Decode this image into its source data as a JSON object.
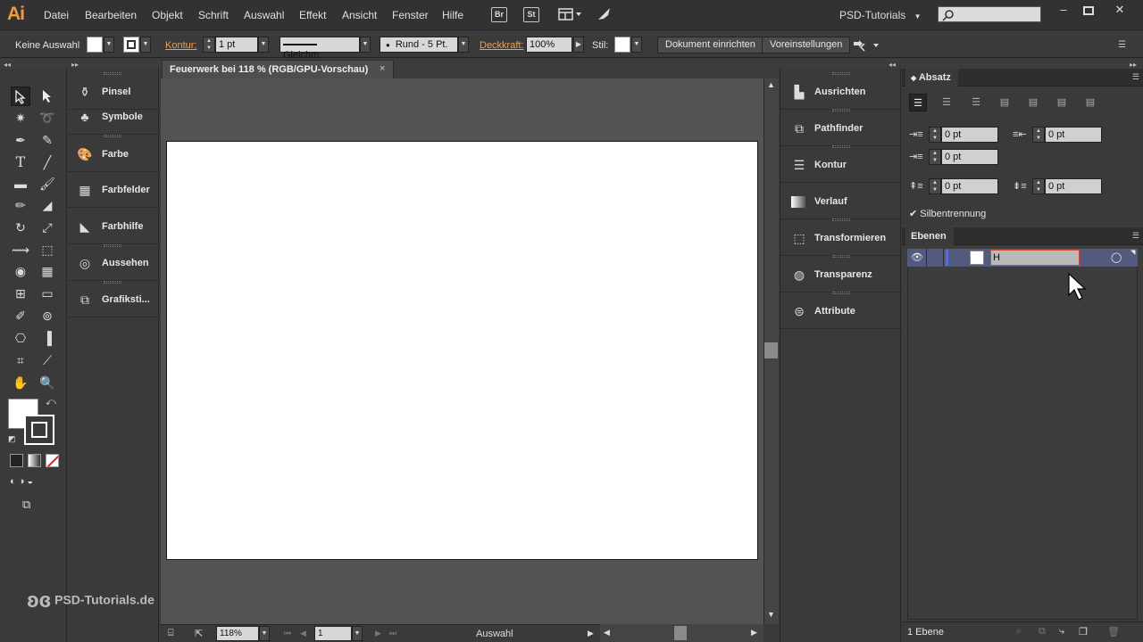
{
  "menubar": {
    "logo": "Ai",
    "items": [
      "Datei",
      "Bearbeiten",
      "Objekt",
      "Schrift",
      "Auswahl",
      "Effekt",
      "Ansicht",
      "Fenster",
      "Hilfe"
    ],
    "bridge_label": "Br",
    "stock_label": "St",
    "workspace": "PSD-Tutorials",
    "search_placeholder": ""
  },
  "controlbar": {
    "selection_state": "Keine Auswahl",
    "stroke_label": "Kontur:",
    "stroke_weight": "1 pt",
    "stroke_profile": "Gleichm.",
    "brush": "Rund - 5 Pt.",
    "opacity_label": "Deckkraft:",
    "opacity_value": "100%",
    "style_label": "Stil:",
    "doc_setup_button": "Dokument einrichten",
    "preferences_button": "Voreinstellungen"
  },
  "dock1": {
    "items": [
      {
        "label": "Pinsel",
        "icon": "brush-icon"
      },
      {
        "label": "Symbole",
        "icon": "symbols-icon"
      },
      {
        "label": "Farbe",
        "icon": "color-palette-icon"
      },
      {
        "label": "Farbfelder",
        "icon": "swatches-icon"
      },
      {
        "label": "Farbhilfe",
        "icon": "color-guide-icon"
      },
      {
        "label": "Aussehen",
        "icon": "appearance-icon"
      },
      {
        "label": "Grafiksti...",
        "icon": "graphic-styles-icon"
      }
    ]
  },
  "document": {
    "tab_title": "Feuerwerk bei 118 % (RGB/GPU-Vorschau)",
    "close_symbol": "×"
  },
  "statusbar": {
    "zoom": "118%",
    "artboard_number": "1",
    "tool_status": "Auswahl"
  },
  "dock2": {
    "items": [
      {
        "label": "Ausrichten",
        "icon": "align-icon"
      },
      {
        "label": "Pathfinder",
        "icon": "pathfinder-icon"
      },
      {
        "label": "Kontur",
        "icon": "stroke-icon"
      },
      {
        "label": "Verlauf",
        "icon": "gradient-icon"
      },
      {
        "label": "Transformieren",
        "icon": "transform-icon"
      },
      {
        "label": "Transparenz",
        "icon": "transparency-icon"
      },
      {
        "label": "Attribute",
        "icon": "attributes-icon"
      }
    ]
  },
  "paragraph_panel": {
    "title": "Absatz",
    "left_indent": "0 pt",
    "right_indent": "0 pt",
    "first_line_indent": "0 pt",
    "space_before": "0 pt",
    "space_after": "0 pt",
    "hyphenation_label": "Silbentrennung",
    "hyphenation_checked": true
  },
  "layers_panel": {
    "title": "Ebenen",
    "layer_name_value": "H",
    "layer_count": "1 Ebene",
    "layer_color": "#535a7d"
  },
  "watermark": "PSD-Tutorials.de",
  "colors": {
    "accent_orange": "#f39c3e",
    "selection_blue": "#535a7d",
    "edit_border": "#d34a2f"
  }
}
